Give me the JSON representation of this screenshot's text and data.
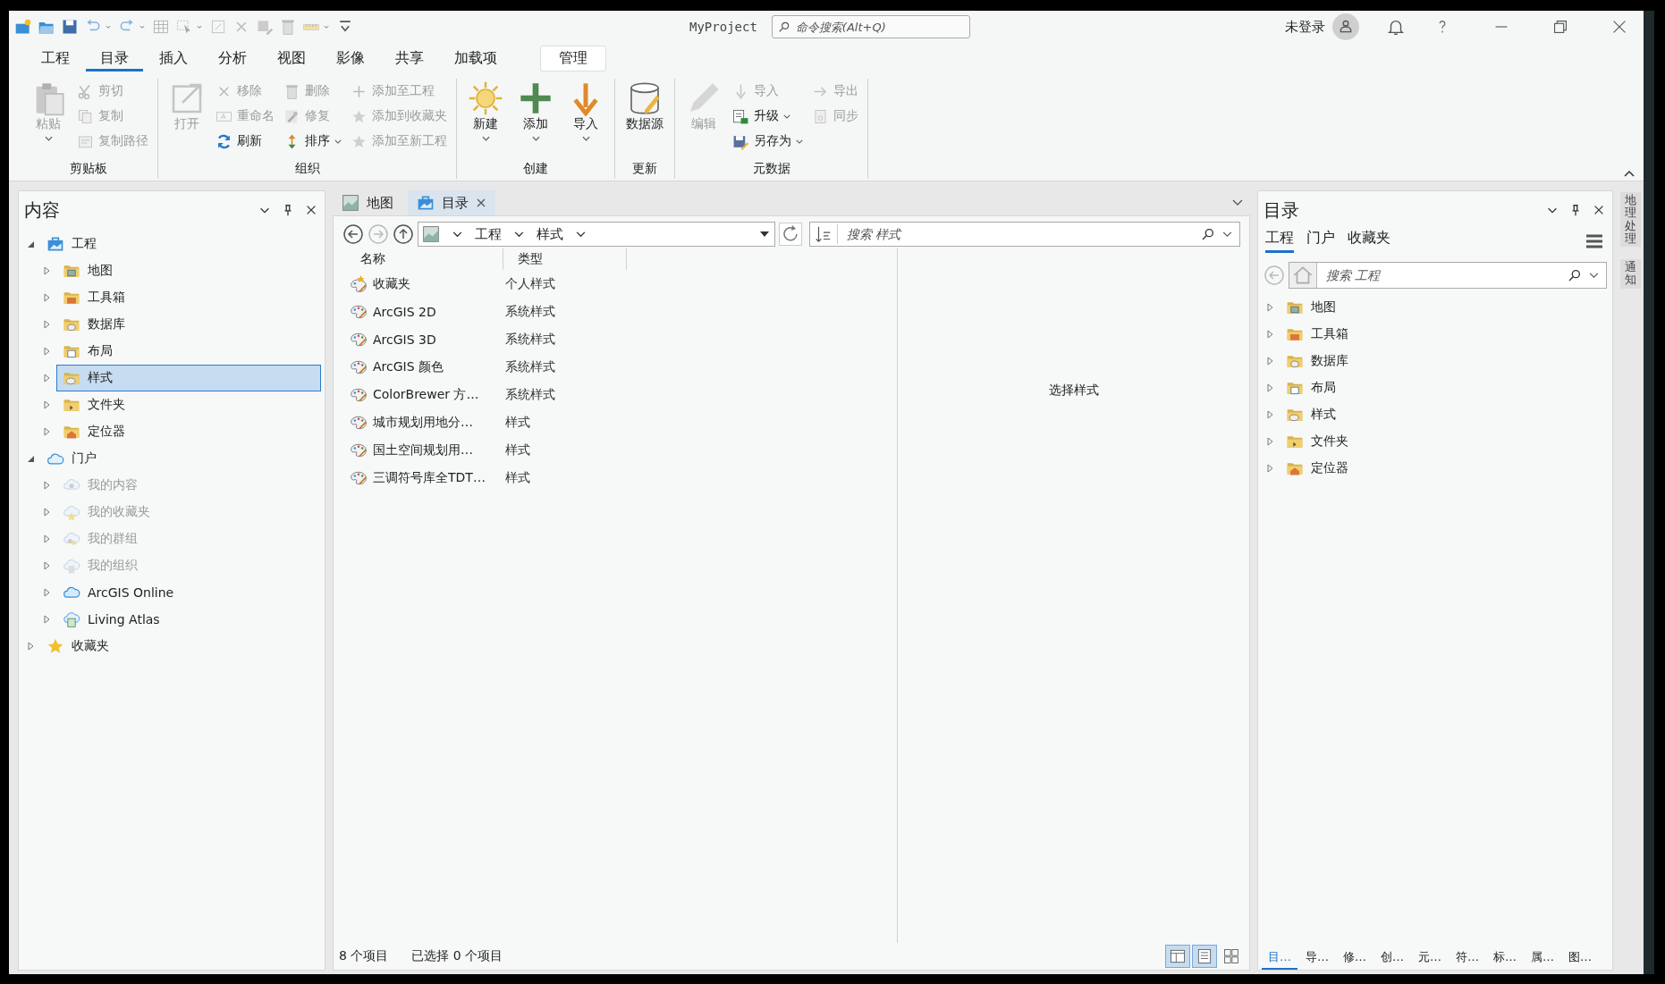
{
  "title_bar": {
    "title": "MyProject",
    "search": {
      "placeholder": "命令搜索(Alt+Q)"
    },
    "user": "未登录"
  },
  "ribbon": {
    "tabs": [
      {
        "label": "工程",
        "selected": false,
        "contextual": false
      },
      {
        "label": "目录",
        "selected": true,
        "contextual": false
      },
      {
        "label": "插入",
        "selected": false,
        "contextual": false
      },
      {
        "label": "分析",
        "selected": false,
        "contextual": false
      },
      {
        "label": "视图",
        "selected": false,
        "contextual": false
      },
      {
        "label": "影像",
        "selected": false,
        "contextual": false
      },
      {
        "label": "共享",
        "selected": false,
        "contextual": false
      },
      {
        "label": "加载项",
        "selected": false,
        "contextual": false
      },
      {
        "label": "管理",
        "selected": false,
        "contextual": true
      }
    ],
    "groups": [
      {
        "label": "剪贴板",
        "large": [
          {
            "label": "粘贴",
            "kind": "paste",
            "disabled": true,
            "dropdown": true
          }
        ],
        "columns": [
          [
            {
              "label": "剪切",
              "kind": "cut",
              "disabled": true,
              "dropdown": false
            },
            {
              "label": "复制",
              "kind": "copy",
              "disabled": true,
              "dropdown": false
            },
            {
              "label": "复制路径",
              "kind": "copypath",
              "disabled": true,
              "dropdown": false
            }
          ]
        ]
      },
      {
        "label": "组织",
        "large": [
          {
            "label": "打开",
            "kind": "open",
            "disabled": true,
            "dropdown": false
          }
        ],
        "columns": [
          [
            {
              "label": "移除",
              "kind": "remove",
              "disabled": true,
              "dropdown": false
            },
            {
              "label": "重命名",
              "kind": "rename",
              "disabled": true,
              "dropdown": false
            },
            {
              "label": "刷新",
              "kind": "refresh",
              "disabled": false,
              "dropdown": false
            }
          ],
          [
            {
              "label": "删除",
              "kind": "delete",
              "disabled": true,
              "dropdown": false
            },
            {
              "label": "修复",
              "kind": "repair",
              "disabled": true,
              "dropdown": false
            },
            {
              "label": "排序",
              "kind": "sort",
              "disabled": false,
              "dropdown": true
            }
          ],
          [
            {
              "label": "添加至工程",
              "kind": "addproject",
              "disabled": true,
              "dropdown": false
            },
            {
              "label": "添加到收藏夹",
              "kind": "favorite",
              "disabled": true,
              "dropdown": false
            },
            {
              "label": "添加至新工程",
              "kind": "favorite",
              "disabled": true,
              "dropdown": false
            }
          ]
        ]
      },
      {
        "label": "创建",
        "large": [
          {
            "label": "新建",
            "kind": "new",
            "disabled": false,
            "dropdown": true
          },
          {
            "label": "添加",
            "kind": "add",
            "disabled": false,
            "dropdown": true
          },
          {
            "label": "导入",
            "kind": "import",
            "disabled": false,
            "dropdown": true
          }
        ]
      },
      {
        "label": "更新",
        "large": [
          {
            "label": "数据源",
            "kind": "datasource",
            "disabled": false,
            "dropdown": false
          }
        ]
      },
      {
        "label": "元数据",
        "large": [
          {
            "label": "编辑",
            "kind": "edit",
            "disabled": true,
            "dropdown": false
          }
        ],
        "columns": [
          [
            {
              "label": "导入",
              "kind": "importsmall",
              "disabled": true,
              "dropdown": false
            },
            {
              "label": "升级",
              "kind": "upgrade",
              "disabled": false,
              "dropdown": true
            },
            {
              "label": "另存为",
              "kind": "saveas",
              "disabled": false,
              "dropdown": true
            }
          ],
          [
            {
              "label": "导出",
              "kind": "export",
              "disabled": true,
              "dropdown": false
            },
            {
              "label": "同步",
              "kind": "sync",
              "disabled": true,
              "dropdown": false
            }
          ]
        ]
      }
    ]
  },
  "contents_pane": {
    "title": "内容",
    "tree": [
      {
        "label": "工程",
        "kind": "project",
        "expanded": true,
        "disabled": false,
        "selected": false,
        "children": [
          {
            "label": "地图",
            "kind": "maps",
            "expanded": false,
            "disabled": false,
            "selected": false
          },
          {
            "label": "工具箱",
            "kind": "toolboxes",
            "expanded": false,
            "disabled": false,
            "selected": false
          },
          {
            "label": "数据库",
            "kind": "databases",
            "expanded": false,
            "disabled": false,
            "selected": false
          },
          {
            "label": "布局",
            "kind": "layouts",
            "expanded": false,
            "disabled": false,
            "selected": false
          },
          {
            "label": "样式",
            "kind": "styles",
            "expanded": false,
            "disabled": false,
            "selected": true
          },
          {
            "label": "文件夹",
            "kind": "folders",
            "expanded": false,
            "disabled": false,
            "selected": false
          },
          {
            "label": "定位器",
            "kind": "locators",
            "expanded": false,
            "disabled": false,
            "selected": false
          }
        ]
      },
      {
        "label": "门户",
        "kind": "portal",
        "expanded": true,
        "disabled": false,
        "selected": false,
        "children": [
          {
            "label": "我的内容",
            "kind": "mycontent",
            "expanded": false,
            "disabled": true,
            "selected": false
          },
          {
            "label": "我的收藏夹",
            "kind": "myfavorites",
            "expanded": false,
            "disabled": true,
            "selected": false
          },
          {
            "label": "我的群组",
            "kind": "mygroups",
            "expanded": false,
            "disabled": true,
            "selected": false
          },
          {
            "label": "我的组织",
            "kind": "myorg",
            "expanded": false,
            "disabled": true,
            "selected": false
          },
          {
            "label": "ArcGIS Online",
            "kind": "online",
            "expanded": false,
            "disabled": false,
            "selected": false
          },
          {
            "label": "Living Atlas",
            "kind": "atlas",
            "expanded": false,
            "disabled": false,
            "selected": false
          }
        ]
      },
      {
        "label": "收藏夹",
        "kind": "favorites",
        "expanded": false,
        "disabled": false,
        "selected": false
      }
    ]
  },
  "view": {
    "tabs": [
      {
        "label": "地图",
        "kind": "map",
        "selected": false,
        "closable": false
      },
      {
        "label": "目录",
        "kind": "catalog",
        "selected": true,
        "closable": true
      }
    ],
    "breadcrumb": [
      "工程",
      "样式"
    ],
    "search": {
      "placeholder": "搜索 样式"
    },
    "columns": [
      "名称",
      "类型"
    ],
    "rows": [
      {
        "name": "收藏夹",
        "type": "个人样式",
        "kind": "favorites"
      },
      {
        "name": "ArcGIS 2D",
        "type": "系统样式",
        "kind": "style"
      },
      {
        "name": "ArcGIS 3D",
        "type": "系统样式",
        "kind": "style"
      },
      {
        "name": "ArcGIS 颜色",
        "type": "系统样式",
        "kind": "style"
      },
      {
        "name": "ColorBrewer 方…",
        "type": "系统样式",
        "kind": "style"
      },
      {
        "name": "城市规划用地分…",
        "type": "样式",
        "kind": "style"
      },
      {
        "name": "国土空间规划用…",
        "type": "样式",
        "kind": "style"
      },
      {
        "name": "三调符号库全TDT…",
        "type": "样式",
        "kind": "style"
      }
    ],
    "preview": "选择样式",
    "status": {
      "count": "8 个项目",
      "selected": "已选择 0 个项目"
    },
    "view_modes": [
      {
        "kind": "preview",
        "selected": true
      },
      {
        "kind": "details",
        "selected": true
      },
      {
        "kind": "tiles",
        "selected": false
      }
    ]
  },
  "catalog_pane": {
    "title": "目录",
    "tabs": [
      {
        "label": "工程",
        "selected": true
      },
      {
        "label": "门户",
        "selected": false
      },
      {
        "label": "收藏夹",
        "selected": false
      }
    ],
    "search": {
      "placeholder": "搜索 工程"
    },
    "tree": [
      {
        "label": "地图",
        "kind": "maps",
        "expanded": false,
        "selected": false
      },
      {
        "label": "工具箱",
        "kind": "toolboxes",
        "expanded": false,
        "selected": false
      },
      {
        "label": "数据库",
        "kind": "databases",
        "expanded": false,
        "selected": false
      },
      {
        "label": "布局",
        "kind": "layouts",
        "expanded": false,
        "selected": false
      },
      {
        "label": "样式",
        "kind": "styles",
        "expanded": false,
        "selected": false
      },
      {
        "label": "文件夹",
        "kind": "folders",
        "expanded": false,
        "selected": false
      },
      {
        "label": "定位器",
        "kind": "locators",
        "expanded": false,
        "selected": false
      }
    ],
    "bottom_tabs": [
      {
        "label": "目…",
        "selected": true
      },
      {
        "label": "导…",
        "selected": false
      },
      {
        "label": "修…",
        "selected": false
      },
      {
        "label": "创…",
        "selected": false
      },
      {
        "label": "元…",
        "selected": false
      },
      {
        "label": "符…",
        "selected": false
      },
      {
        "label": "标…",
        "selected": false
      },
      {
        "label": "属…",
        "selected": false
      },
      {
        "label": "图…",
        "selected": false
      }
    ]
  },
  "side_tabs": [
    "地理处理",
    "通知"
  ]
}
